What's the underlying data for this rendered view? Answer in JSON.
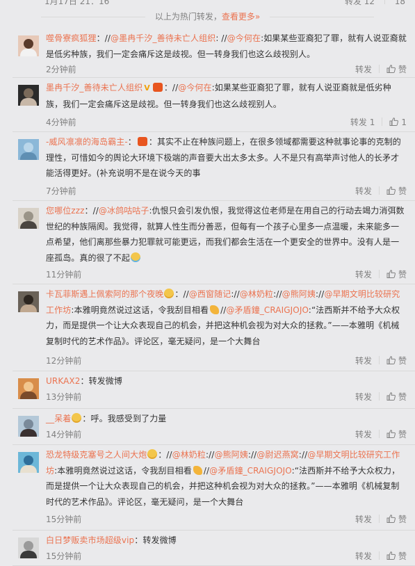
{
  "top_row": {
    "time": "1月17日 21：16",
    "repost": "转发 12",
    "like": "18"
  },
  "hot_line": {
    "text": "以上为热门转发，",
    "more": "查看更多»"
  },
  "labels": {
    "repost": "转发",
    "like": "赞"
  },
  "comments": [
    {
      "user": "噬骨寮疯狐狸",
      "segments": [
        {
          "t": "sep",
          "v": "：//"
        },
        {
          "t": "mention",
          "v": "@墨冉千汐_善待未亡人组织"
        },
        {
          "t": "sep",
          "v": ": //"
        },
        {
          "t": "mention",
          "v": "@今何在"
        },
        {
          "t": "text",
          "v": ":如果某些亚裔犯了罪，就有人说亚裔就是低劣种族，我们一定会痛斥这是歧视。但一转身我们也这么歧视别人。"
        }
      ],
      "time": "2分钟前",
      "repost": "转发",
      "like": "赞"
    },
    {
      "user": "墨冉千汐_善待未亡人组织",
      "segments": [
        {
          "t": "vip",
          "v": "V"
        },
        {
          "t": "badge",
          "v": ""
        },
        {
          "t": "sep",
          "v": "：//"
        },
        {
          "t": "mention",
          "v": "@今何在"
        },
        {
          "t": "text",
          "v": ":如果某些亚裔犯了罪，就有人说亚裔就是低劣种族，我们一定会痛斥这是歧视。但一转身我们也这么歧视别人。"
        }
      ],
      "time": "4分钟前",
      "repost": "转发 1",
      "like": "1"
    },
    {
      "user": "-威风凛凛的海岛霸主-",
      "segments": [
        {
          "t": "sep",
          "v": "："
        },
        {
          "t": "badge",
          "v": ""
        },
        {
          "t": "text",
          "v": "：其实不止在种族问题上，在很多领域都需要这种就事论事的克制的理性，可惜如今的舆论大环境下极端的声音要大出太多太多。人不是只有高举声讨他人的长矛才能活得更好。(补充说明不是在说今天的事"
        }
      ],
      "time": "7分钟前",
      "repost": "转发",
      "like": "赞"
    },
    {
      "user": "您哪位zzz",
      "segments": [
        {
          "t": "sep",
          "v": "：//"
        },
        {
          "t": "mention",
          "v": "@冰鸽咕咕子"
        },
        {
          "t": "text",
          "v": ":仇恨只会引发仇恨，我觉得这位老师是在用自己的行动去竭力消弭数世纪的种族隔阂。我觉得，就算人性生而分善恶，但每有一个孩子心里多一点温暖，未来能多一点希望，他们离那些暴力犯罪就可能更远，而我们都会生活在一个更安全的世界中。没有人是一座孤岛。真的很了不起"
        },
        {
          "t": "cry",
          "v": ""
        }
      ],
      "time": "11分钟前",
      "repost": "转发",
      "like": "赞"
    },
    {
      "user": "卡瓦菲斯遇上佩索阿的那个夜晚",
      "segments": [
        {
          "t": "face",
          "v": ""
        },
        {
          "t": "sep",
          "v": "：//"
        },
        {
          "t": "mention",
          "v": "@西窗随记"
        },
        {
          "t": "sep",
          "v": "://"
        },
        {
          "t": "mention",
          "v": "@林奶粒"
        },
        {
          "t": "sep",
          "v": "://"
        },
        {
          "t": "mention",
          "v": "@熊阿姨"
        },
        {
          "t": "sep",
          "v": "://"
        },
        {
          "t": "mention",
          "v": "@早期文明比较研究工作坊"
        },
        {
          "t": "text",
          "v": ":本雅明竟然说过这话，令我刮目相看"
        },
        {
          "t": "hand",
          "v": ""
        },
        {
          "t": "sep",
          "v": "//"
        },
        {
          "t": "mention",
          "v": "@矛盾鐘_CRAIGJOJO"
        },
        {
          "t": "text",
          "v": ":“法西斯并不给予大众权力，而是提供一个让大众表现自己的机会，并把这种机会视为对大众的拯救。”——本雅明《机械复制时代的艺术作品》。评论区，毫无疑问，是一个大舞台"
        }
      ],
      "time": "12分钟前",
      "repost": "转发",
      "like": "赞"
    },
    {
      "user": "URKAX2",
      "segments": [
        {
          "t": "text",
          "v": "：转发微博"
        }
      ],
      "time": "13分钟前",
      "repost": "转发",
      "like": "赞"
    },
    {
      "user": "__呆着",
      "segments": [
        {
          "t": "face",
          "v": ""
        },
        {
          "t": "text",
          "v": "：呼。我感受到了力量"
        }
      ],
      "time": "14分钟前",
      "repost": "转发",
      "like": "赞"
    },
    {
      "user": "恐龙特级克塞号之人间大炮",
      "segments": [
        {
          "t": "face",
          "v": ""
        },
        {
          "t": "sep",
          "v": "：//"
        },
        {
          "t": "mention",
          "v": "@林奶粒"
        },
        {
          "t": "sep",
          "v": "://"
        },
        {
          "t": "mention",
          "v": "@熊阿姨"
        },
        {
          "t": "sep",
          "v": "://"
        },
        {
          "t": "mention",
          "v": "@尉迟燕窝"
        },
        {
          "t": "sep",
          "v": "://"
        },
        {
          "t": "mention",
          "v": "@早期文明比较研究工作坊"
        },
        {
          "t": "text",
          "v": ":本雅明竟然说过这话，令我刮目相看"
        },
        {
          "t": "hand",
          "v": ""
        },
        {
          "t": "sep",
          "v": "//"
        },
        {
          "t": "mention",
          "v": "@矛盾鐘_CRAIGJOJO"
        },
        {
          "t": "text",
          "v": ":“法西斯并不给予大众权力，而是提供一个让大众表现自己的机会，并把这种机会视为对大众的拯救。”——本雅明《机械复制时代的艺术作品》。评论区，毫无疑问，是一个大舞台"
        }
      ],
      "time": "15分钟前",
      "repost": "转发",
      "like": "赞"
    },
    {
      "user": "白日梦贩卖市场超级vip",
      "segments": [
        {
          "t": "text",
          "v": "：转发微博"
        }
      ],
      "time": "15分钟前",
      "repost": "转发",
      "like": "赞"
    }
  ],
  "colors": {
    "accent": "#eb7350",
    "muted": "#808080",
    "text": "#333333",
    "background": "#eaeaec",
    "divider": "#d9d9d9"
  },
  "icons": {
    "like": "thumbs-up-icon"
  }
}
